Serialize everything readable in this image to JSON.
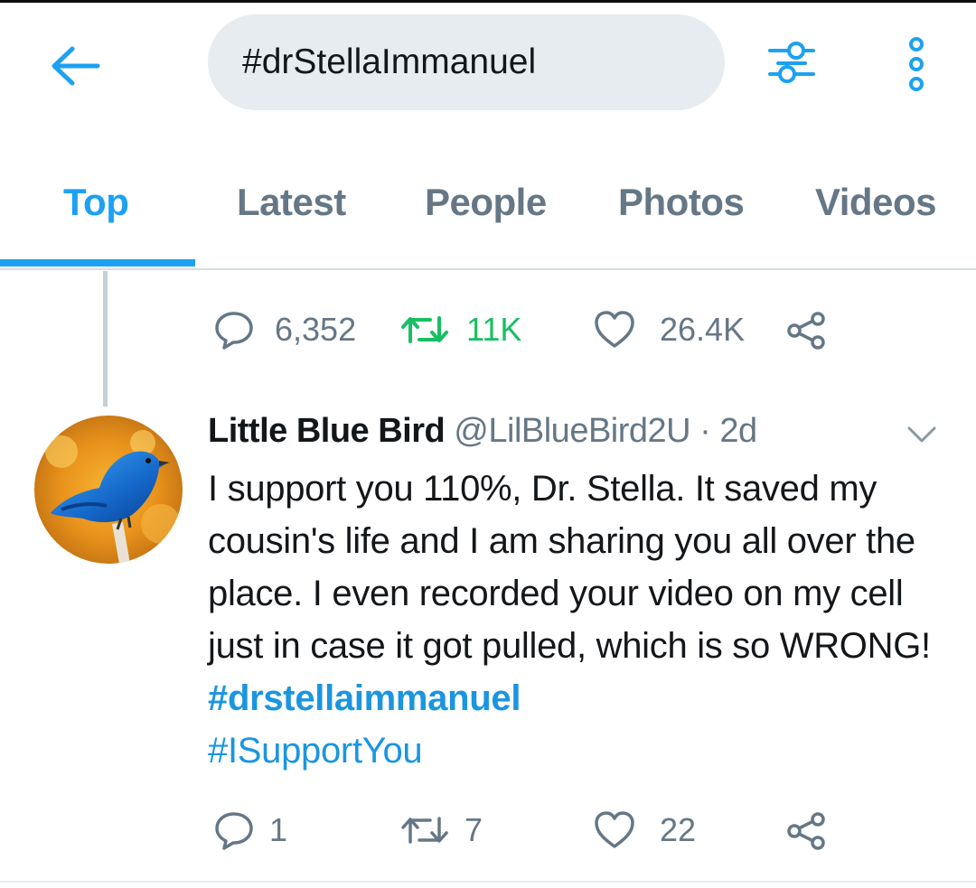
{
  "header": {
    "search": {
      "value": "#drStellaImmanuel"
    },
    "back_icon": "arrow-left-icon",
    "filter_icon": "sliders-icon",
    "more_icon": "more-vertical-icon"
  },
  "tabs": [
    {
      "label": "Top",
      "active": true
    },
    {
      "label": "Latest",
      "active": false
    },
    {
      "label": "People",
      "active": false
    },
    {
      "label": "Photos",
      "active": false
    },
    {
      "label": "Videos",
      "active": false
    }
  ],
  "parent_actions": {
    "replies": "6,352",
    "retweets": "11K",
    "likes": "26.4K",
    "retweeted": true
  },
  "tweet": {
    "name": "Little Blue Bird",
    "handle": "@LilBlueBird2U",
    "separator": "·",
    "time": "2d",
    "text_plain": "I support you 110%, Dr. Stella. It saved my cousin's life and I am sharing you all over the place. I even recorded your video on my cell just in case it got pulled, which is so WRONG! ",
    "hashtag_1": "#drstellaimmanuel",
    "hashtag_2": "#ISupportYou",
    "actions": {
      "replies": "1",
      "retweets": "7",
      "likes": "22"
    }
  },
  "colors": {
    "accent": "#1da1f2",
    "retweet_green": "#17bf63",
    "muted": "#657786",
    "search_bg": "#e6ecf0"
  }
}
